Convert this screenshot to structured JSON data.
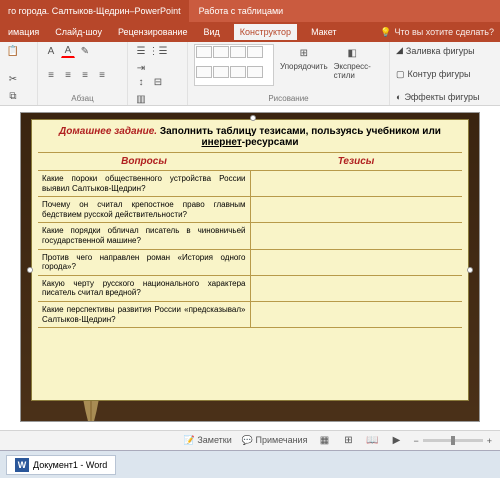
{
  "title": {
    "doc": "го города. Салтыков-Щедрин",
    "app": "PowerPoint",
    "context": "Работа с таблицами"
  },
  "tabs": {
    "t0": "имация",
    "t1": "Слайд-шоу",
    "t2": "Рецензирование",
    "t3": "Вид",
    "t4": "Конструктор",
    "t5": "Макет",
    "tell": "Что вы хотите сделать?"
  },
  "ribbon": {
    "g1": "Абзац",
    "g2": "Рисование",
    "arrange": "Упорядочить",
    "express": "Экспресс-\nстили",
    "fill": "Заливка фигуры",
    "outline": "Контур фигуры",
    "effects": "Эффекты фигуры"
  },
  "slide": {
    "hw_red": "Домашнее задание.",
    "hw_rest": " Заполнить таблицу тезисами, пользуясь учебником или ",
    "hw_link": "инернет",
    "hw_rest2": "-ресурсами",
    "col1": "Вопросы",
    "col2": "Тезисы",
    "q1": "Какие пороки общественного устройства России выявил Салтыков-Щедрин?",
    "q2": "Почему он считал крепостное право главным бедствием русской действительности?",
    "q3": "Какие порядки обличал писатель в чиновничьей государственной машине?",
    "q4": "Против чего направлен роман «История одного города»?",
    "q5": "Какую черту русского национального характера писатель считал вредной?",
    "q6": "Какие перспективы развития России «предсказывал» Салтыков-Щедрин?"
  },
  "status": {
    "notes": "Заметки",
    "comments": "Примечания"
  },
  "taskbar": {
    "doc": "Документ1 - Word"
  }
}
